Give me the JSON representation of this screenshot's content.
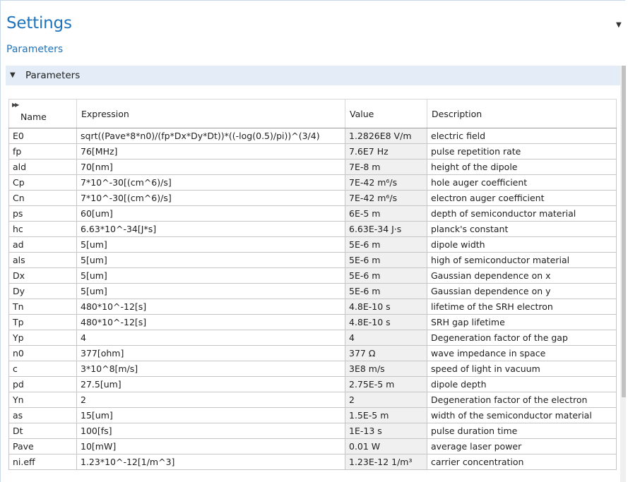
{
  "header": {
    "title": "Settings",
    "subtitle": "Parameters"
  },
  "section": {
    "label": "Parameters"
  },
  "table": {
    "columns": [
      "Name",
      "Expression",
      "Value",
      "Description"
    ],
    "rows": [
      {
        "name": "E0",
        "expression": "sqrt((Pave*8*n0)/(fp*Dx*Dy*Dt))*((-log(0.5)/pi))^(3/4)",
        "value": "1.2826E8 V/m",
        "description": "electric field"
      },
      {
        "name": "fp",
        "expression": "76[MHz]",
        "value": "7.6E7 Hz",
        "description": "pulse repetition rate"
      },
      {
        "name": "ald",
        "expression": "70[nm]",
        "value": "7E-8 m",
        "description": "height of the dipole"
      },
      {
        "name": "Cp",
        "expression": "7*10^-30[(cm^6)/s]",
        "value": "7E-42 m⁶/s",
        "description": "hole auger coefficient"
      },
      {
        "name": "Cn",
        "expression": "7*10^-30[(cm^6)/s]",
        "value": "7E-42 m⁶/s",
        "description": "electron auger coefficient"
      },
      {
        "name": "ps",
        "expression": "60[um]",
        "value": "6E-5 m",
        "description": "depth of semiconductor material"
      },
      {
        "name": "hc",
        "expression": "6.63*10^-34[J*s]",
        "value": "6.63E-34 J·s",
        "description": "planck's constant"
      },
      {
        "name": "ad",
        "expression": "5[um]",
        "value": "5E-6 m",
        "description": "dipole width"
      },
      {
        "name": "als",
        "expression": "5[um]",
        "value": "5E-6 m",
        "description": "high of semiconductor material"
      },
      {
        "name": "Dx",
        "expression": "5[um]",
        "value": "5E-6 m",
        "description": "Gaussian dependence on x"
      },
      {
        "name": "Dy",
        "expression": "5[um]",
        "value": "5E-6 m",
        "description": "Gaussian dependence on y"
      },
      {
        "name": "Tn",
        "expression": "480*10^-12[s]",
        "value": "4.8E-10 s",
        "description": "lifetime of the SRH electron"
      },
      {
        "name": "Tp",
        "expression": "480*10^-12[s]",
        "value": "4.8E-10 s",
        "description": "SRH gap lifetime"
      },
      {
        "name": "Yp",
        "expression": "4",
        "value": "4",
        "description": "Degeneration factor of the gap"
      },
      {
        "name": "n0",
        "expression": "377[ohm]",
        "value": "377 Ω",
        "description": "wave impedance in space"
      },
      {
        "name": "c",
        "expression": "3*10^8[m/s]",
        "value": "3E8 m/s",
        "description": "speed of light in vacuum"
      },
      {
        "name": "pd",
        "expression": "27.5[um]",
        "value": "2.75E-5 m",
        "description": "dipole depth"
      },
      {
        "name": "Yn",
        "expression": "2",
        "value": "2",
        "description": "Degeneration factor of the electron"
      },
      {
        "name": "as",
        "expression": "15[um]",
        "value": "1.5E-5 m",
        "description": "width of the semiconductor material"
      },
      {
        "name": "Dt",
        "expression": "100[fs]",
        "value": "1E-13 s",
        "description": "pulse duration time"
      },
      {
        "name": "Pave",
        "expression": "10[mW]",
        "value": "0.01 W",
        "description": "average laser power"
      },
      {
        "name": "ni.eff",
        "expression": "1.23*10^-12[1/m^3]",
        "value": "1.23E-12 1/m³",
        "description": "carrier concentration"
      }
    ]
  },
  "colors": {
    "accent": "#1e73be",
    "section_bg": "#e4edf7",
    "value_cell_bg": "#f0f0f0"
  }
}
